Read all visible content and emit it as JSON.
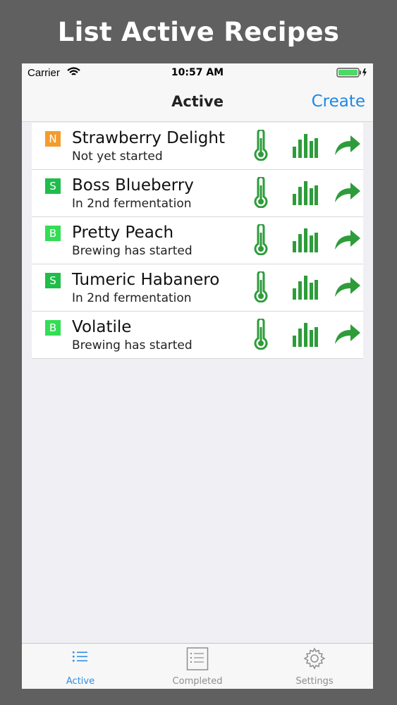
{
  "banner": "List Active Recipes",
  "status": {
    "carrier": "Carrier",
    "time": "10:57 AM",
    "wifi_icon": "wifi-icon",
    "battery_icon": "battery-charging-icon"
  },
  "nav": {
    "title": "Active",
    "create_label": "Create"
  },
  "colors": {
    "accent": "#1e88e5",
    "action_green": "#2e9c3a",
    "badge_orange": "#f39c2e",
    "badge_green": "#27c04a"
  },
  "recipes": [
    {
      "badge": "N",
      "badge_color": "#f39c2e",
      "name": "Strawberry Delight",
      "status": "Not yet started"
    },
    {
      "badge": "S",
      "badge_color": "#1fbd4a",
      "name": "Boss Blueberry",
      "status": "In 2nd fermentation"
    },
    {
      "badge": "B",
      "badge_color": "#33dd55",
      "name": "Pretty Peach",
      "status": "Brewing has started"
    },
    {
      "badge": "S",
      "badge_color": "#1fbd4a",
      "name": "Tumeric Habanero",
      "status": "In 2nd fermentation"
    },
    {
      "badge": "B",
      "badge_color": "#33dd55",
      "name": "Volatile",
      "status": "Brewing has started"
    }
  ],
  "row_icons": [
    "thermometer-icon",
    "bar-chart-icon",
    "share-arrow-icon"
  ],
  "tabs": [
    {
      "label": "Active",
      "icon": "list-icon",
      "selected": true
    },
    {
      "label": "Completed",
      "icon": "document-list-icon",
      "selected": false
    },
    {
      "label": "Settings",
      "icon": "gear-icon",
      "selected": false
    }
  ]
}
